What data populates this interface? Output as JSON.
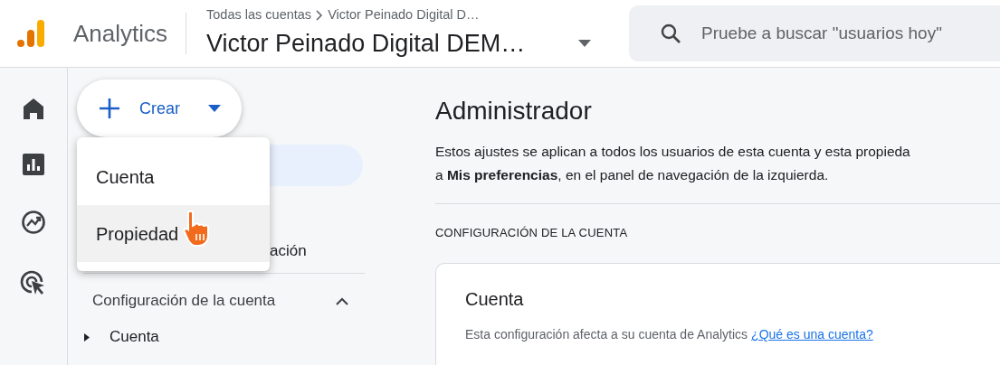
{
  "header": {
    "product": "Analytics",
    "breadcrumb": [
      "Todas las cuentas",
      "Victor Peinado Digital D…"
    ],
    "property": "Victor Peinado Digital DEM…",
    "search": {
      "placeholder": "Pruebe a buscar \"usuarios hoy\""
    }
  },
  "nav_rail": [
    {
      "kind": "home"
    },
    {
      "kind": "reports"
    },
    {
      "kind": "explore"
    },
    {
      "kind": "advertising"
    }
  ],
  "create_button": {
    "label": "Crear"
  },
  "create_menu": [
    {
      "label": "Cuenta",
      "hovered": false
    },
    {
      "label": "Propiedad",
      "hovered": true
    }
  ],
  "sidebar": {
    "partial_item": "ación",
    "section": {
      "label": "Configuración de la cuenta",
      "expanded": true
    },
    "items": [
      {
        "label": "Cuenta",
        "expanded": false
      }
    ]
  },
  "main": {
    "title": "Administrador",
    "description": "Estos ajustes se aplican a todos los usuarios de esta cuenta y esta propieda\na **Mis preferencias**, en el panel de navegación de la izquierda.",
    "section_label": "CONFIGURACIÓN DE LA CUENTA",
    "card": {
      "title": "Cuenta",
      "text": "Esta configuración afecta a su cuenta de Analytics",
      "link": "¿Qué es una cuenta?"
    }
  }
}
